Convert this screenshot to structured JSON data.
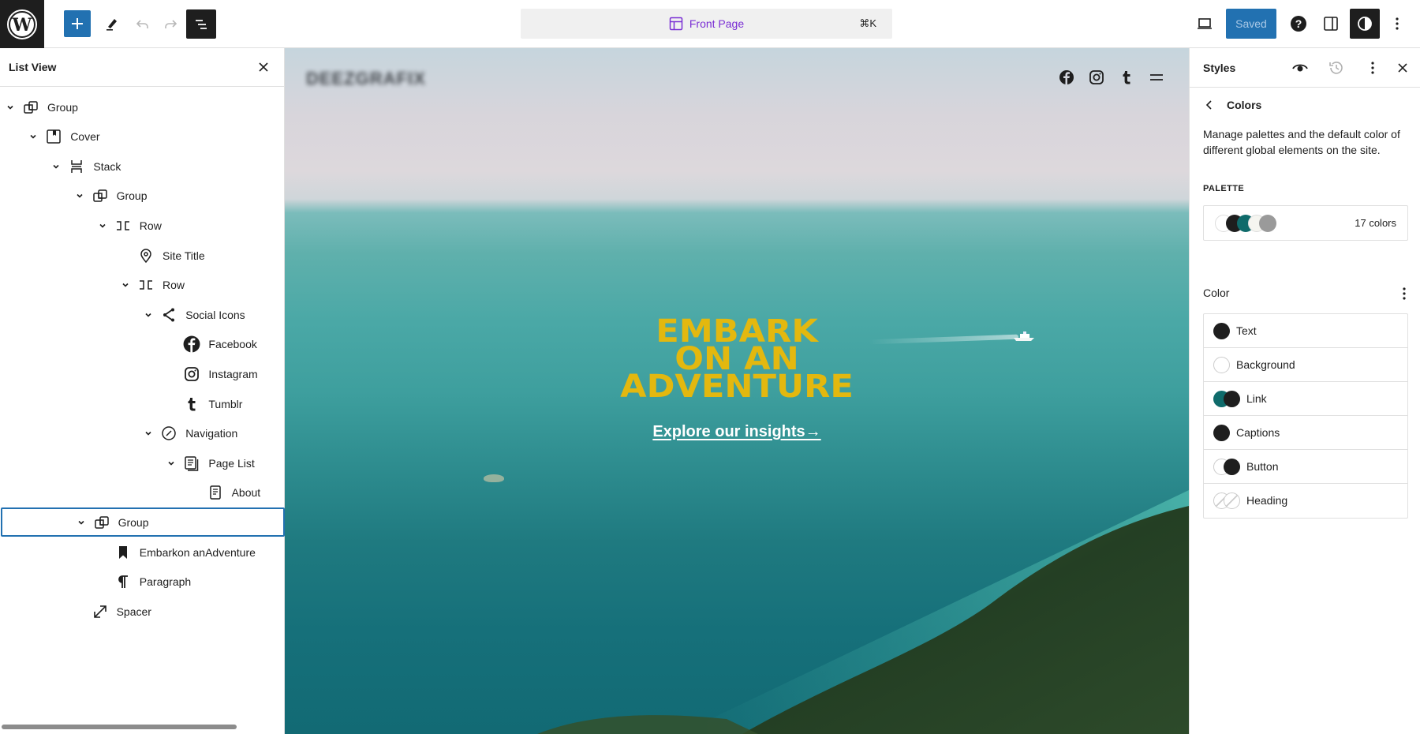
{
  "topbar": {
    "logo": "wordpress-logo",
    "add_block_icon": "plus-icon",
    "tools_icon": "pencil-icon",
    "undo_icon": "undo-icon",
    "redo_icon": "redo-icon",
    "list_view_icon": "list-view-icon",
    "command": {
      "icon": "layout-icon",
      "title": "Front Page",
      "shortcut": "⌘K"
    },
    "device_preview_icon": "desktop-icon",
    "save_label": "Saved",
    "help_icon": "help-icon",
    "settings_icon": "sidebar-icon",
    "styles_icon": "half-circle-icon",
    "more_icon": "vertical-dots-icon"
  },
  "list_view": {
    "title": "List View",
    "close_icon": "close-icon",
    "items": [
      {
        "label": "Group",
        "icon": "group-icon",
        "depth": 0,
        "expanded": true
      },
      {
        "label": "Cover",
        "icon": "cover-icon",
        "depth": 1,
        "expanded": true
      },
      {
        "label": "Stack",
        "icon": "stack-icon",
        "depth": 2,
        "expanded": true
      },
      {
        "label": "Group",
        "icon": "group-icon",
        "depth": 3,
        "expanded": true
      },
      {
        "label": "Row",
        "icon": "row-icon",
        "depth": 4,
        "expanded": true
      },
      {
        "label": "Site Title",
        "icon": "map-pin-icon",
        "depth": 5,
        "expanded": null
      },
      {
        "label": "Row",
        "icon": "row-icon",
        "depth": 5,
        "expanded": true
      },
      {
        "label": "Social Icons",
        "icon": "share-icon",
        "depth": 6,
        "expanded": true
      },
      {
        "label": "Facebook",
        "icon": "facebook-icon",
        "depth": 7,
        "expanded": null
      },
      {
        "label": "Instagram",
        "icon": "instagram-icon",
        "depth": 7,
        "expanded": null
      },
      {
        "label": "Tumblr",
        "icon": "tumblr-icon",
        "depth": 7,
        "expanded": null
      },
      {
        "label": "Navigation",
        "icon": "navigation-icon",
        "depth": 6,
        "expanded": true
      },
      {
        "label": "Page List",
        "icon": "pages-icon",
        "depth": 7,
        "expanded": true
      },
      {
        "label": "About",
        "icon": "page-icon",
        "depth": 8,
        "expanded": null
      },
      {
        "label": "Group",
        "icon": "group-icon",
        "depth": 3,
        "expanded": true,
        "selected": true
      },
      {
        "label": "Embarkon anAdventure",
        "icon": "bookmark-icon",
        "depth": 4,
        "expanded": null
      },
      {
        "label": "Paragraph",
        "icon": "paragraph-icon",
        "depth": 4,
        "expanded": null
      },
      {
        "label": "Spacer",
        "icon": "resize-icon",
        "depth": 3,
        "expanded": null
      }
    ]
  },
  "canvas": {
    "site_title": "DEEZGRAFIX",
    "social": [
      "facebook-icon",
      "instagram-icon",
      "tumblr-icon",
      "menu-icon"
    ],
    "heading_lines": [
      "EMBARK",
      "ON AN",
      "ADVENTURE"
    ],
    "link_text": "Explore our insights→",
    "heading_color": "#e3b80f"
  },
  "styles_panel": {
    "title": "Styles",
    "header_icons": [
      "eye-icon",
      "revisions-icon",
      "vertical-dots-icon",
      "close-icon"
    ],
    "section_title": "Colors",
    "description": "Manage palettes and the default color of different global elements on the site.",
    "palette_label": "PALETTE",
    "palette_swatches": [
      "#ffffff",
      "#1e1e1e",
      "#0f6b6b",
      "#f5f5f0",
      "#9a9a9a"
    ],
    "palette_count": "17 colors",
    "color_heading": "Color",
    "color_items": [
      {
        "label": "Text",
        "swatches": [
          "#1e1e1e"
        ]
      },
      {
        "label": "Background",
        "swatches": [
          "#ffffff"
        ]
      },
      {
        "label": "Link",
        "swatches": [
          "#0f6b6b",
          "#1e1e1e"
        ]
      },
      {
        "label": "Captions",
        "swatches": [
          "#1e1e1e"
        ]
      },
      {
        "label": "Button",
        "swatches": [
          "#ffffff",
          "#1e1e1e"
        ]
      },
      {
        "label": "Heading",
        "swatches": [
          "transparent",
          "transparent"
        ]
      }
    ]
  }
}
